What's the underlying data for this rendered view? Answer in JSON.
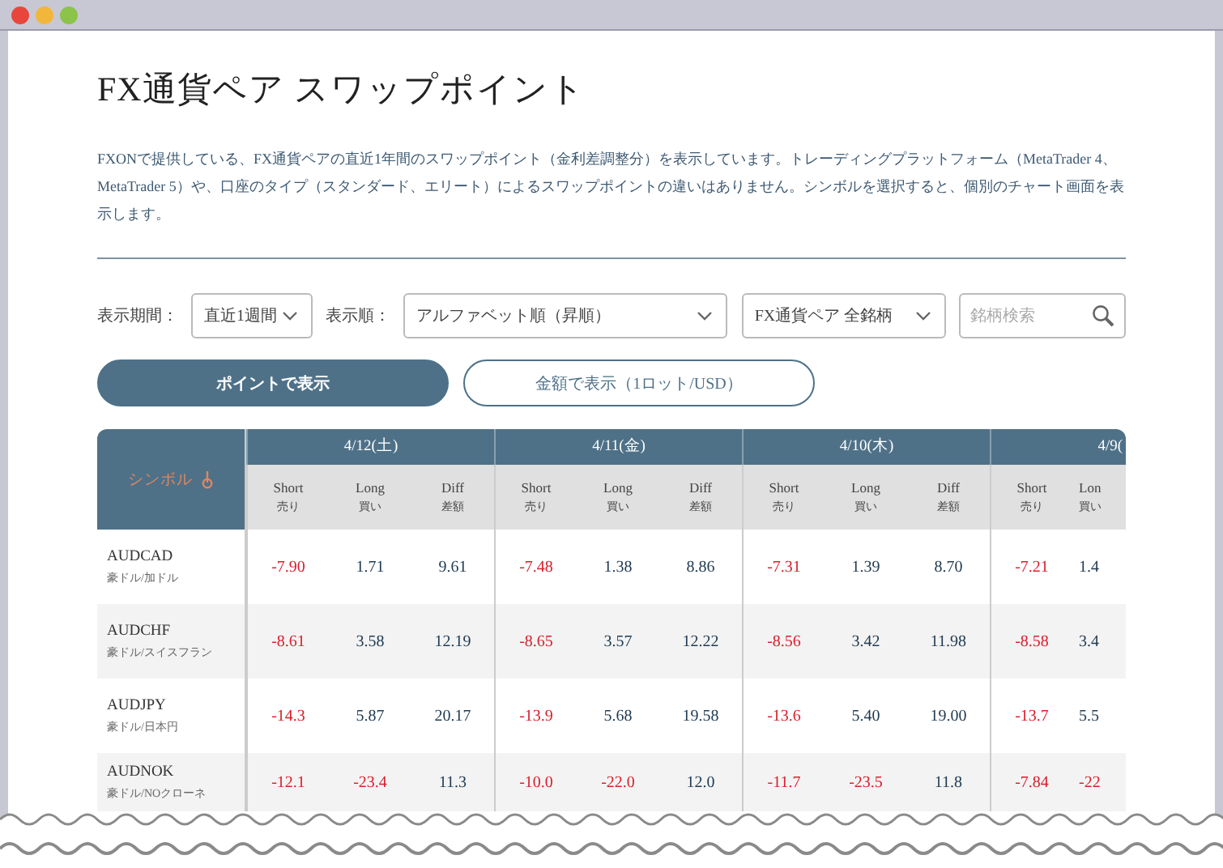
{
  "page": {
    "title": "FX通貨ペア スワップポイント",
    "description": "FXONで提供している、FX通貨ペアの直近1年間のスワップポイント（金利差調整分）を表示しています。トレーディングプラットフォーム（MetaTrader 4、MetaTrader 5）や、口座のタイプ（スタンダード、エリート）によるスワップポイントの違いはありません。シンボルを選択すると、個別のチャート画面を表示します。"
  },
  "filters": {
    "period_label": "表示期間：",
    "period": "直近1週間",
    "order_label": "表示順：",
    "order": "アルファベット順（昇順）",
    "category": "FX通貨ペア 全銘柄",
    "search": {
      "placeholder": "銘柄検索"
    }
  },
  "view_toggle": [
    {
      "label": "ポイントで表示",
      "selected": true
    },
    {
      "label": "金額で表示（1ロット/USD）",
      "selected": false
    }
  ],
  "table": {
    "symbol_header": "シンボル",
    "dates": [
      {
        "label": "4/12(土)",
        "columns": [
          {
            "en": "Short",
            "ja": "売り"
          },
          {
            "en": "Long",
            "ja": "買い"
          },
          {
            "en": "Diff",
            "ja": "差額"
          }
        ]
      },
      {
        "label": "4/11(金)",
        "columns": [
          {
            "en": "Short",
            "ja": "売り"
          },
          {
            "en": "Long",
            "ja": "買い"
          },
          {
            "en": "Diff",
            "ja": "差額"
          }
        ]
      },
      {
        "label": "4/10(木)",
        "columns": [
          {
            "en": "Short",
            "ja": "売り"
          },
          {
            "en": "Long",
            "ja": "買い"
          },
          {
            "en": "Diff",
            "ja": "差額"
          }
        ]
      },
      {
        "label": "4/9(",
        "columns": [
          {
            "en": "Short",
            "ja": "売り"
          },
          {
            "en": "Lon",
            "ja": "買い"
          }
        ]
      }
    ],
    "rows": [
      {
        "symbol": "AUDCAD",
        "name": "豪ドル/加ドル",
        "values": [
          {
            "text": "-7.90",
            "negative": true
          },
          {
            "text": "1.71",
            "negative": false
          },
          {
            "text": "9.61",
            "negative": false
          },
          {
            "text": "-7.48",
            "negative": true
          },
          {
            "text": "1.38",
            "negative": false
          },
          {
            "text": "8.86",
            "negative": false
          },
          {
            "text": "-7.31",
            "negative": true
          },
          {
            "text": "1.39",
            "negative": false
          },
          {
            "text": "8.70",
            "negative": false
          },
          {
            "text": "-7.21",
            "negative": true
          },
          {
            "text": "1.4",
            "negative": false
          }
        ]
      },
      {
        "symbol": "AUDCHF",
        "name": "豪ドル/スイスフラン",
        "values": [
          {
            "text": "-8.61",
            "negative": true
          },
          {
            "text": "3.58",
            "negative": false
          },
          {
            "text": "12.19",
            "negative": false
          },
          {
            "text": "-8.65",
            "negative": true
          },
          {
            "text": "3.57",
            "negative": false
          },
          {
            "text": "12.22",
            "negative": false
          },
          {
            "text": "-8.56",
            "negative": true
          },
          {
            "text": "3.42",
            "negative": false
          },
          {
            "text": "11.98",
            "negative": false
          },
          {
            "text": "-8.58",
            "negative": true
          },
          {
            "text": "3.4",
            "negative": false
          }
        ]
      },
      {
        "symbol": "AUDJPY",
        "name": "豪ドル/日本円",
        "values": [
          {
            "text": "-14.3",
            "negative": true
          },
          {
            "text": "5.87",
            "negative": false
          },
          {
            "text": "20.17",
            "negative": false
          },
          {
            "text": "-13.9",
            "negative": true
          },
          {
            "text": "5.68",
            "negative": false
          },
          {
            "text": "19.58",
            "negative": false
          },
          {
            "text": "-13.6",
            "negative": true
          },
          {
            "text": "5.40",
            "negative": false
          },
          {
            "text": "19.00",
            "negative": false
          },
          {
            "text": "-13.7",
            "negative": true
          },
          {
            "text": "5.5",
            "negative": false
          }
        ]
      },
      {
        "symbol": "AUDNOK",
        "name": "豪ドル/NOクローネ",
        "values": [
          {
            "text": "-12.1",
            "negative": true
          },
          {
            "text": "-23.4",
            "negative": true
          },
          {
            "text": "11.3",
            "negative": false
          },
          {
            "text": "-10.0",
            "negative": true
          },
          {
            "text": "-22.0",
            "negative": true
          },
          {
            "text": "12.0",
            "negative": false
          },
          {
            "text": "-11.7",
            "negative": true
          },
          {
            "text": "-23.5",
            "negative": true
          },
          {
            "text": "11.8",
            "negative": false
          },
          {
            "text": "-7.84",
            "negative": true
          },
          {
            "text": "-22",
            "negative": true
          }
        ]
      }
    ]
  }
}
